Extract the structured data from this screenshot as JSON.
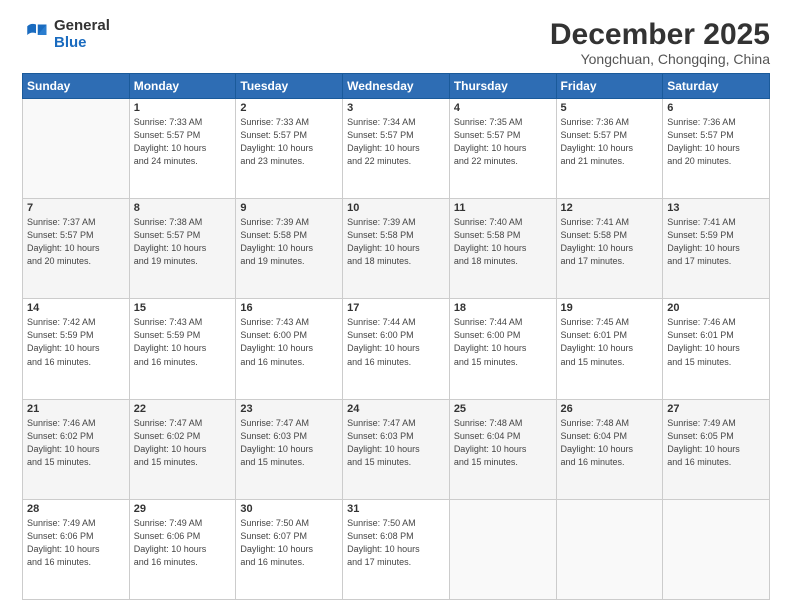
{
  "logo": {
    "general": "General",
    "blue": "Blue"
  },
  "header": {
    "title": "December 2025",
    "subtitle": "Yongchuan, Chongqing, China"
  },
  "weekdays": [
    "Sunday",
    "Monday",
    "Tuesday",
    "Wednesday",
    "Thursday",
    "Friday",
    "Saturday"
  ],
  "weeks": [
    [
      {
        "day": "",
        "info": ""
      },
      {
        "day": "1",
        "info": "Sunrise: 7:33 AM\nSunset: 5:57 PM\nDaylight: 10 hours\nand 24 minutes."
      },
      {
        "day": "2",
        "info": "Sunrise: 7:33 AM\nSunset: 5:57 PM\nDaylight: 10 hours\nand 23 minutes."
      },
      {
        "day": "3",
        "info": "Sunrise: 7:34 AM\nSunset: 5:57 PM\nDaylight: 10 hours\nand 22 minutes."
      },
      {
        "day": "4",
        "info": "Sunrise: 7:35 AM\nSunset: 5:57 PM\nDaylight: 10 hours\nand 22 minutes."
      },
      {
        "day": "5",
        "info": "Sunrise: 7:36 AM\nSunset: 5:57 PM\nDaylight: 10 hours\nand 21 minutes."
      },
      {
        "day": "6",
        "info": "Sunrise: 7:36 AM\nSunset: 5:57 PM\nDaylight: 10 hours\nand 20 minutes."
      }
    ],
    [
      {
        "day": "7",
        "info": "Sunrise: 7:37 AM\nSunset: 5:57 PM\nDaylight: 10 hours\nand 20 minutes."
      },
      {
        "day": "8",
        "info": "Sunrise: 7:38 AM\nSunset: 5:57 PM\nDaylight: 10 hours\nand 19 minutes."
      },
      {
        "day": "9",
        "info": "Sunrise: 7:39 AM\nSunset: 5:58 PM\nDaylight: 10 hours\nand 19 minutes."
      },
      {
        "day": "10",
        "info": "Sunrise: 7:39 AM\nSunset: 5:58 PM\nDaylight: 10 hours\nand 18 minutes."
      },
      {
        "day": "11",
        "info": "Sunrise: 7:40 AM\nSunset: 5:58 PM\nDaylight: 10 hours\nand 18 minutes."
      },
      {
        "day": "12",
        "info": "Sunrise: 7:41 AM\nSunset: 5:58 PM\nDaylight: 10 hours\nand 17 minutes."
      },
      {
        "day": "13",
        "info": "Sunrise: 7:41 AM\nSunset: 5:59 PM\nDaylight: 10 hours\nand 17 minutes."
      }
    ],
    [
      {
        "day": "14",
        "info": "Sunrise: 7:42 AM\nSunset: 5:59 PM\nDaylight: 10 hours\nand 16 minutes."
      },
      {
        "day": "15",
        "info": "Sunrise: 7:43 AM\nSunset: 5:59 PM\nDaylight: 10 hours\nand 16 minutes."
      },
      {
        "day": "16",
        "info": "Sunrise: 7:43 AM\nSunset: 6:00 PM\nDaylight: 10 hours\nand 16 minutes."
      },
      {
        "day": "17",
        "info": "Sunrise: 7:44 AM\nSunset: 6:00 PM\nDaylight: 10 hours\nand 16 minutes."
      },
      {
        "day": "18",
        "info": "Sunrise: 7:44 AM\nSunset: 6:00 PM\nDaylight: 10 hours\nand 15 minutes."
      },
      {
        "day": "19",
        "info": "Sunrise: 7:45 AM\nSunset: 6:01 PM\nDaylight: 10 hours\nand 15 minutes."
      },
      {
        "day": "20",
        "info": "Sunrise: 7:46 AM\nSunset: 6:01 PM\nDaylight: 10 hours\nand 15 minutes."
      }
    ],
    [
      {
        "day": "21",
        "info": "Sunrise: 7:46 AM\nSunset: 6:02 PM\nDaylight: 10 hours\nand 15 minutes."
      },
      {
        "day": "22",
        "info": "Sunrise: 7:47 AM\nSunset: 6:02 PM\nDaylight: 10 hours\nand 15 minutes."
      },
      {
        "day": "23",
        "info": "Sunrise: 7:47 AM\nSunset: 6:03 PM\nDaylight: 10 hours\nand 15 minutes."
      },
      {
        "day": "24",
        "info": "Sunrise: 7:47 AM\nSunset: 6:03 PM\nDaylight: 10 hours\nand 15 minutes."
      },
      {
        "day": "25",
        "info": "Sunrise: 7:48 AM\nSunset: 6:04 PM\nDaylight: 10 hours\nand 15 minutes."
      },
      {
        "day": "26",
        "info": "Sunrise: 7:48 AM\nSunset: 6:04 PM\nDaylight: 10 hours\nand 16 minutes."
      },
      {
        "day": "27",
        "info": "Sunrise: 7:49 AM\nSunset: 6:05 PM\nDaylight: 10 hours\nand 16 minutes."
      }
    ],
    [
      {
        "day": "28",
        "info": "Sunrise: 7:49 AM\nSunset: 6:06 PM\nDaylight: 10 hours\nand 16 minutes."
      },
      {
        "day": "29",
        "info": "Sunrise: 7:49 AM\nSunset: 6:06 PM\nDaylight: 10 hours\nand 16 minutes."
      },
      {
        "day": "30",
        "info": "Sunrise: 7:50 AM\nSunset: 6:07 PM\nDaylight: 10 hours\nand 16 minutes."
      },
      {
        "day": "31",
        "info": "Sunrise: 7:50 AM\nSunset: 6:08 PM\nDaylight: 10 hours\nand 17 minutes."
      },
      {
        "day": "",
        "info": ""
      },
      {
        "day": "",
        "info": ""
      },
      {
        "day": "",
        "info": ""
      }
    ]
  ]
}
